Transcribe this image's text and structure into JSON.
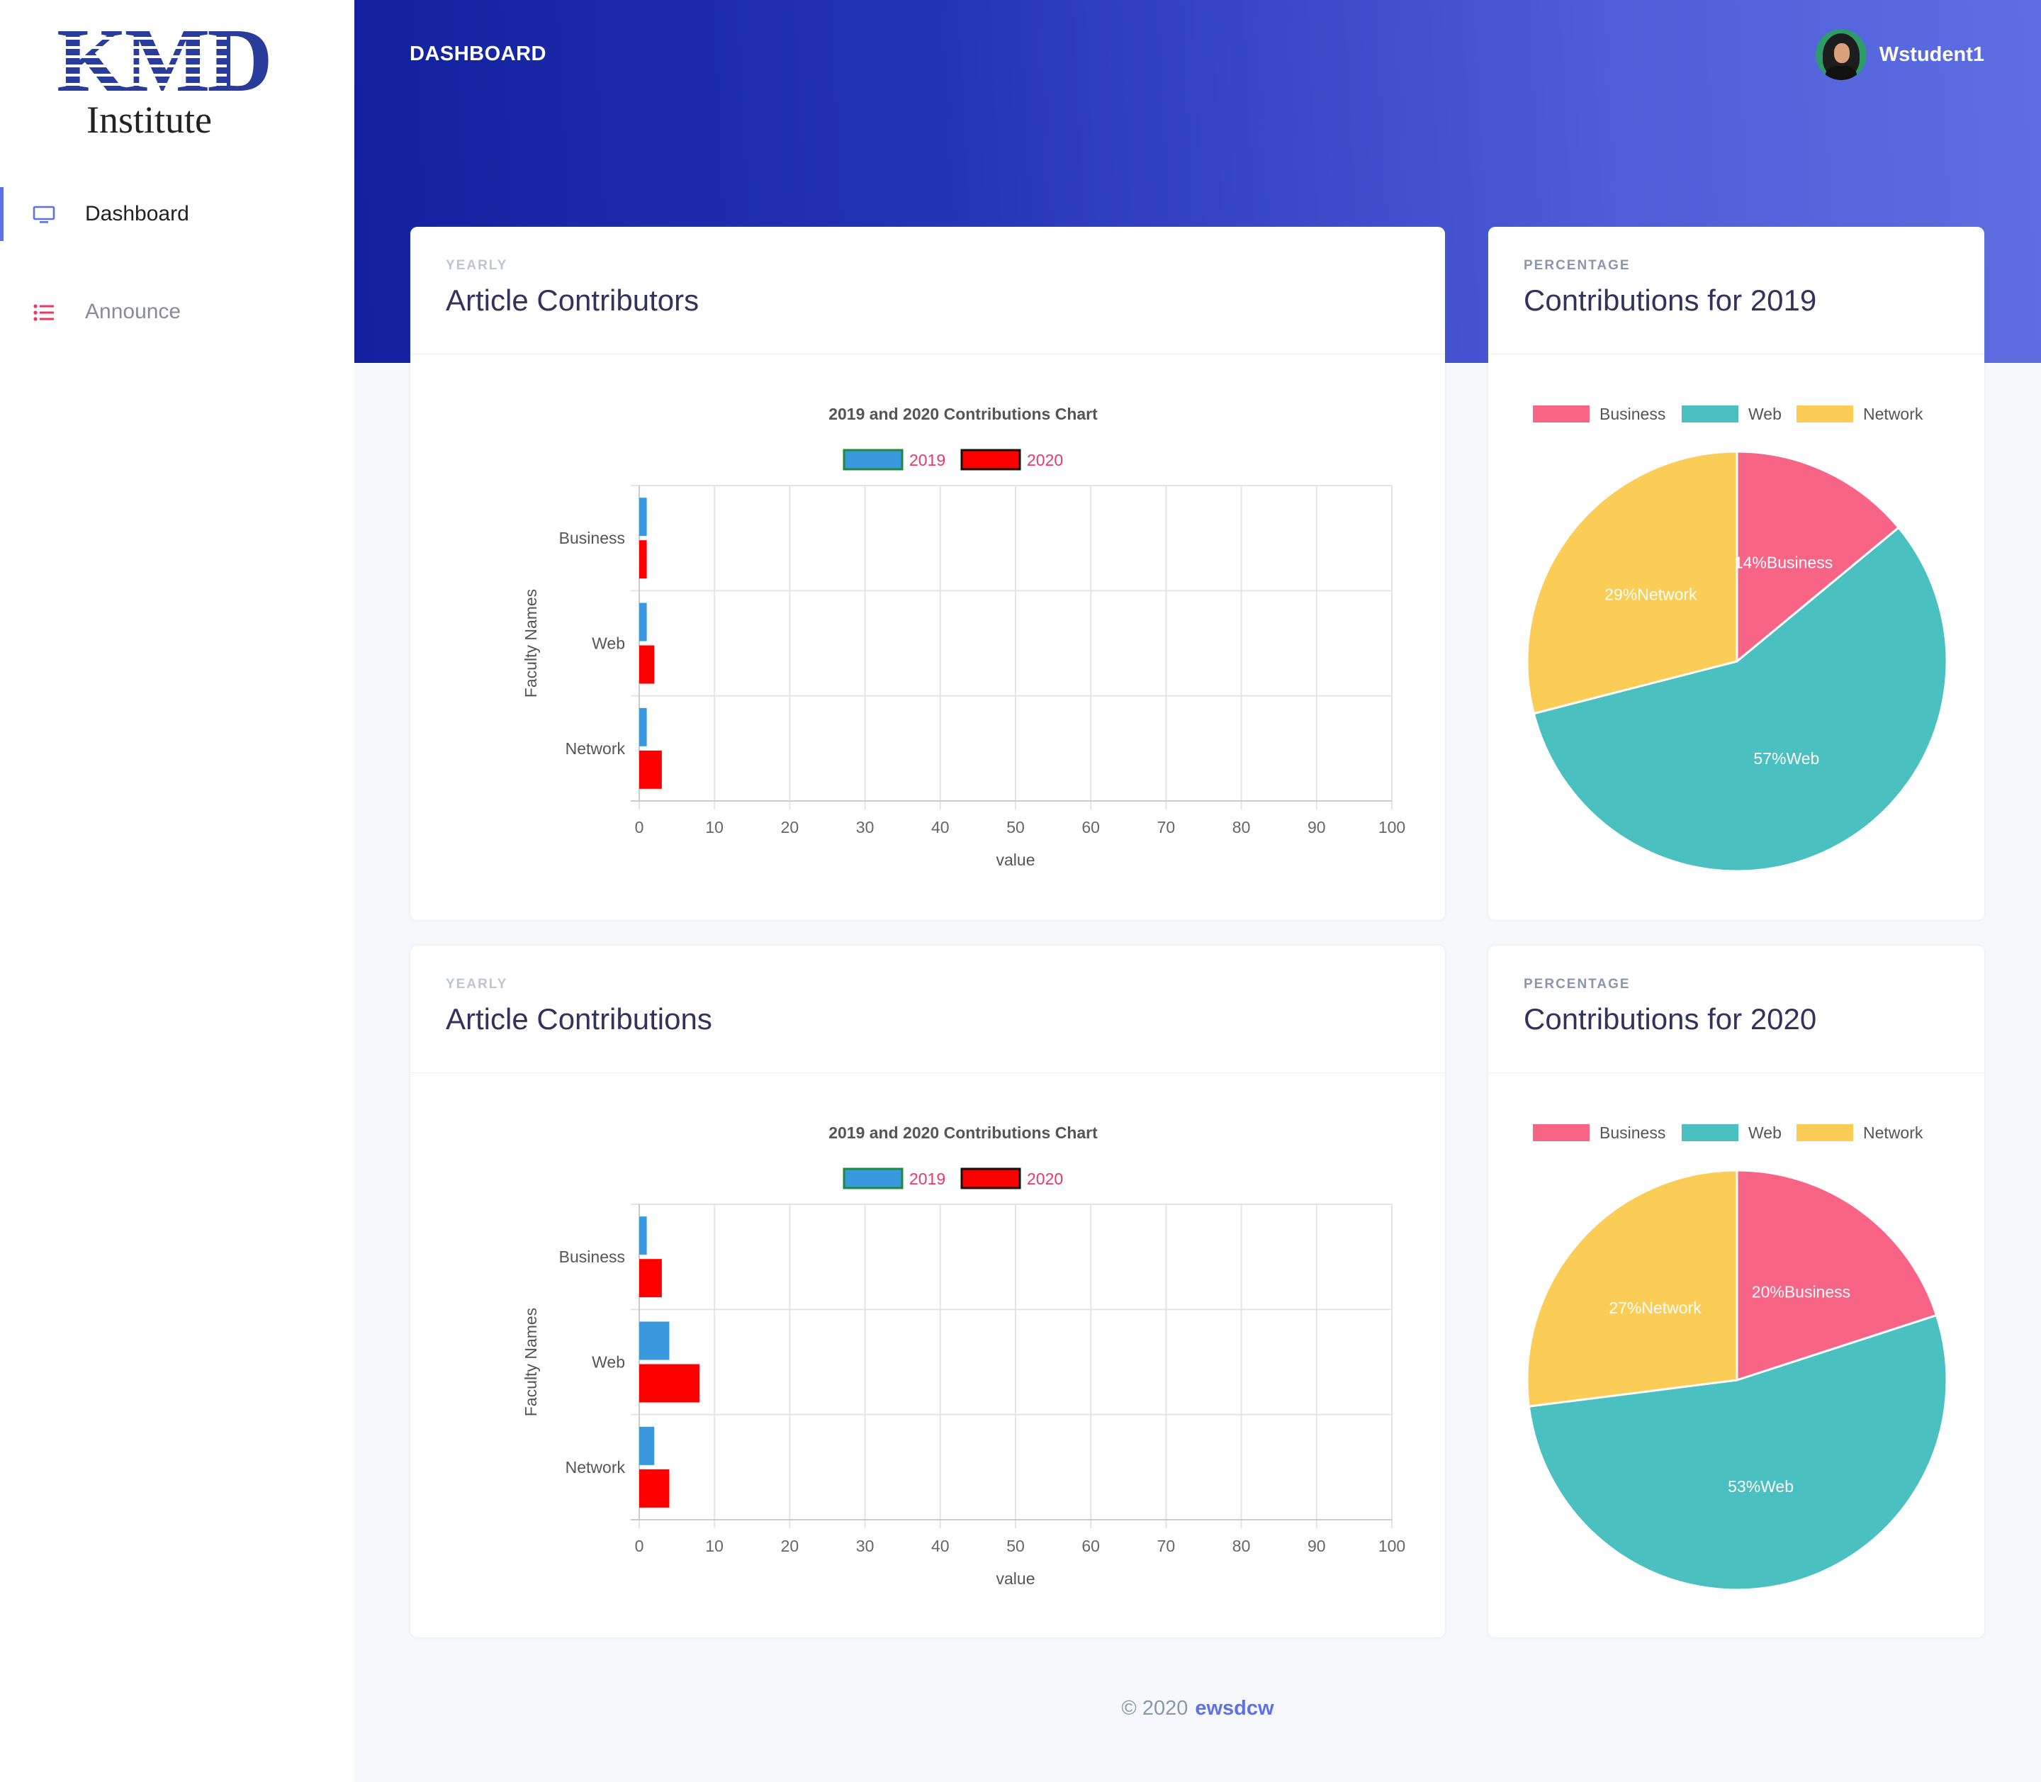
{
  "logo": {
    "title": "KMD",
    "subtitle": "Institute"
  },
  "sidebar": {
    "items": [
      {
        "label": "Dashboard",
        "icon": "monitor-icon",
        "active": true
      },
      {
        "label": "Announce",
        "icon": "list-icon",
        "active": false
      }
    ]
  },
  "header": {
    "title": "DASHBOARD",
    "user_name": "Wstudent1"
  },
  "cards": {
    "contributors": {
      "kicker": "YEARLY",
      "title": "Article Contributors"
    },
    "pie2019": {
      "kicker": "PERCENTAGE",
      "title": "Contributions for 2019"
    },
    "contributions": {
      "kicker": "YEARLY",
      "title": "Article Contributions"
    },
    "pie2020": {
      "kicker": "PERCENTAGE",
      "title": "Contributions for 2020"
    }
  },
  "footer": {
    "copyright": "© 2020",
    "brand": "ewsdcw"
  },
  "colors": {
    "accent": "#5e72e4",
    "series_2019": "#3a99de",
    "series_2020": "#ff0000",
    "business": "#f76486",
    "web": "#4bc0c0",
    "network": "#fbcd57"
  },
  "chart_data": [
    {
      "type": "bar",
      "orientation": "horizontal",
      "title": "2019 and 2020 Contributions Chart",
      "categories": [
        "Business",
        "Web",
        "Network"
      ],
      "series": [
        {
          "name": "2019",
          "values": [
            1,
            1,
            1
          ]
        },
        {
          "name": "2020",
          "values": [
            1,
            2,
            3
          ]
        }
      ],
      "xlabel": "value",
      "ylabel": "Faculty Names",
      "xlim": [
        0,
        100
      ],
      "xticks": [
        "0",
        "10",
        "20",
        "30",
        "40",
        "50",
        "60",
        "70",
        "80",
        "90",
        "100"
      ],
      "grid": true,
      "legend": "top"
    },
    {
      "type": "pie",
      "labels": [
        "Business",
        "Web",
        "Network"
      ],
      "values": [
        14,
        57,
        29
      ],
      "slice_labels": [
        "14%Business",
        "57%Web",
        "29%Network"
      ],
      "legend": "top"
    },
    {
      "type": "bar",
      "orientation": "horizontal",
      "title": "2019 and 2020 Contributions Chart",
      "categories": [
        "Business",
        "Web",
        "Network"
      ],
      "series": [
        {
          "name": "2019",
          "values": [
            1,
            4,
            2
          ]
        },
        {
          "name": "2020",
          "values": [
            3,
            8,
            4
          ]
        }
      ],
      "xlabel": "value",
      "ylabel": "Faculty Names",
      "xlim": [
        0,
        100
      ],
      "xticks": [
        "0",
        "10",
        "20",
        "30",
        "40",
        "50",
        "60",
        "70",
        "80",
        "90",
        "100"
      ],
      "grid": true,
      "legend": "top"
    },
    {
      "type": "pie",
      "labels": [
        "Business",
        "Web",
        "Network"
      ],
      "values": [
        20,
        53,
        27
      ],
      "slice_labels": [
        "20%Business",
        "53%Web",
        "27%Network"
      ],
      "legend": "top"
    }
  ]
}
